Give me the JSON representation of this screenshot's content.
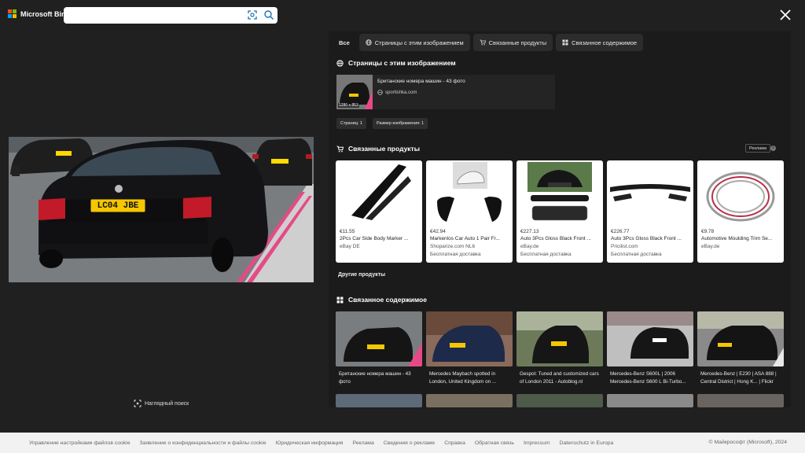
{
  "header": {
    "brand": "Microsoft Bing",
    "search_value": "",
    "search_placeholder": ""
  },
  "tabs": [
    {
      "label": "Все"
    },
    {
      "label": "Страницы с этим изображением"
    },
    {
      "label": "Связанные продукты"
    },
    {
      "label": "Связанное содержимое"
    }
  ],
  "pages_section": {
    "title": "Страницы с этим изображением",
    "result": {
      "title": "Британские номера машин - 43 фото",
      "source": "sportishka.com",
      "image_size": "1280 x 853"
    },
    "chips": [
      "Страниц: 1",
      "Размер изображения: 1"
    ]
  },
  "preview": {
    "plate_text": "LC04 JBE"
  },
  "products_section": {
    "title": "Связанные продукты",
    "ad_label": "Реклама",
    "info_glyph": "i",
    "items": [
      {
        "price": "€11.55",
        "name": "2Pcs Car Side Body Marker ...",
        "store": "eBay DE",
        "shipping": ""
      },
      {
        "price": "€42.94",
        "name": "Markenlos Car Auto 1 Pair Fr...",
        "store": "Shoparize.com NL6",
        "shipping": "Бесплатная доставка"
      },
      {
        "price": "€227.13",
        "name": "Auto 3Pcs Gloss Black Front ...",
        "store": "eBay.de",
        "shipping": "Бесплатная доставка"
      },
      {
        "price": "€226.77",
        "name": "Auto 3Pcs Gloss Black Front ...",
        "store": "Pricilist.com",
        "shipping": "Бесплатная доставка"
      },
      {
        "price": "€9.78",
        "name": "Automotive Moulding Trim Se...",
        "store": "eBay.de",
        "shipping": ""
      }
    ],
    "more_label": "Другие продукты"
  },
  "related_section": {
    "title": "Связанное содержимое",
    "items": [
      {
        "caption": "Британские номера машин - 43 фото"
      },
      {
        "caption": "Mercedes Maybach spotted in London, United Kingdom on ..."
      },
      {
        "caption": "Gespot: Tuned and customized cars of London 2011 - Autoblog.nl"
      },
      {
        "caption": "Mercedes-Benz S600L | 2006 Mercedes-Benz S600 L Bi-Turbo..."
      },
      {
        "caption": "Mercedes-Benz | E230 | ASA 888 | Central District | Hong K... | Flickr"
      }
    ]
  },
  "visual_search_label": "Наглядный поиск",
  "footer": {
    "links": [
      "Управление настройками файлов cookie",
      "Заявление о конфиденциальности и файлы cookie",
      "Юридическая информация",
      "Реклама",
      "Сведения о рекламе",
      "Справка",
      "Обратная связь",
      "Impressum",
      "Datenschutz in Europa"
    ],
    "copyright": "© Майкрософт (Microsoft), 2024"
  },
  "colors": {
    "overlay_bg": "#202020",
    "panel_bg": "#1b1b1b",
    "footer_bg": "#f2f2f2",
    "plate_yellow": "#f6c700"
  }
}
